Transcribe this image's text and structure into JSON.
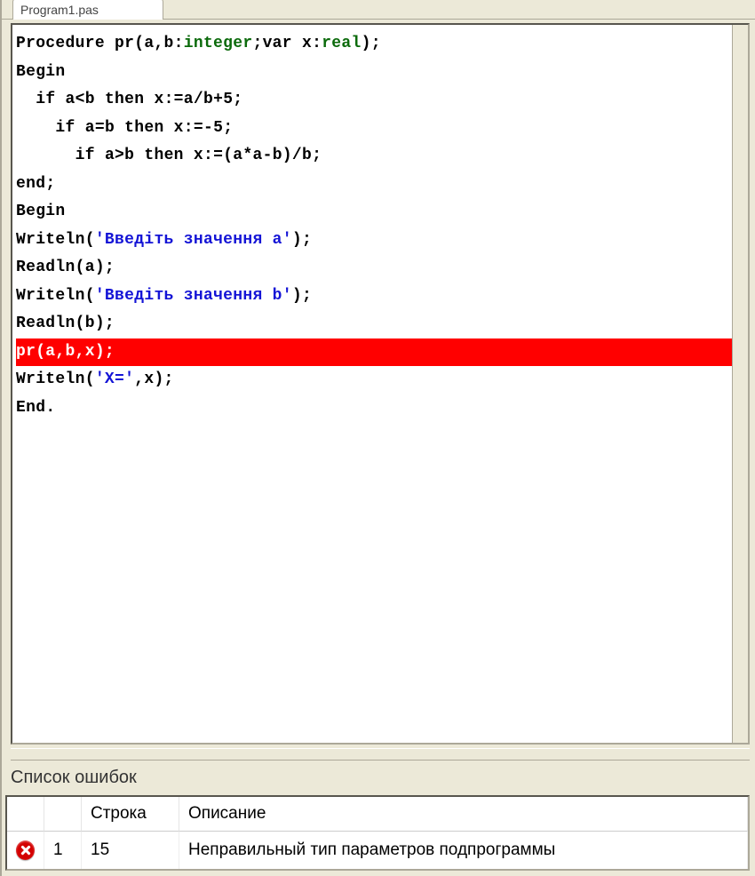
{
  "tab": {
    "label": "Program1.pas"
  },
  "code": {
    "lines": [
      {
        "indent": 0,
        "segments": [
          {
            "t": "Procedure",
            "c": "kw"
          },
          {
            "t": " pr(a,b:",
            "c": ""
          },
          {
            "t": "integer",
            "c": "type"
          },
          {
            "t": ";",
            "c": ""
          },
          {
            "t": "var",
            "c": "kw"
          },
          {
            "t": " x:",
            "c": ""
          },
          {
            "t": "real",
            "c": "type"
          },
          {
            "t": ");",
            "c": ""
          }
        ]
      },
      {
        "indent": 0,
        "segments": [
          {
            "t": "Begin",
            "c": "kw"
          }
        ]
      },
      {
        "indent": 1,
        "segments": [
          {
            "t": "if",
            "c": "kw"
          },
          {
            "t": " a<b ",
            "c": ""
          },
          {
            "t": "then",
            "c": "kw"
          },
          {
            "t": " x:=a/b+5;",
            "c": ""
          }
        ]
      },
      {
        "indent": 2,
        "segments": [
          {
            "t": "if",
            "c": "kw"
          },
          {
            "t": " a=b ",
            "c": ""
          },
          {
            "t": "then",
            "c": "kw"
          },
          {
            "t": " x:=-5;",
            "c": ""
          }
        ]
      },
      {
        "indent": 3,
        "segments": [
          {
            "t": "if",
            "c": "kw"
          },
          {
            "t": " a>b ",
            "c": ""
          },
          {
            "t": "then",
            "c": "kw"
          },
          {
            "t": " x:=(a*a-b)/b;",
            "c": ""
          }
        ]
      },
      {
        "indent": 0,
        "segments": [
          {
            "t": "end",
            "c": "kw"
          },
          {
            "t": ";",
            "c": ""
          }
        ]
      },
      {
        "indent": 0,
        "segments": [
          {
            "t": "Begin",
            "c": "kw"
          }
        ]
      },
      {
        "indent": 0,
        "segments": [
          {
            "t": "Writeln(",
            "c": ""
          },
          {
            "t": "'Введіть значення a'",
            "c": "str"
          },
          {
            "t": ");",
            "c": ""
          }
        ]
      },
      {
        "indent": 0,
        "segments": [
          {
            "t": "Readln(a);",
            "c": ""
          }
        ]
      },
      {
        "indent": 0,
        "segments": [
          {
            "t": "Writeln(",
            "c": ""
          },
          {
            "t": "'Введіть значення b'",
            "c": "str"
          },
          {
            "t": ");",
            "c": ""
          }
        ]
      },
      {
        "indent": 0,
        "segments": [
          {
            "t": "Readln(b);",
            "c": ""
          }
        ]
      },
      {
        "indent": 0,
        "highlight": true,
        "segments": [
          {
            "t": "pr(a,b,x);",
            "c": ""
          }
        ]
      },
      {
        "indent": 0,
        "segments": [
          {
            "t": "Writeln(",
            "c": ""
          },
          {
            "t": "'X='",
            "c": "str"
          },
          {
            "t": ",x);",
            "c": ""
          }
        ]
      },
      {
        "indent": 0,
        "segments": [
          {
            "t": "End",
            "c": "kw"
          },
          {
            "t": ".",
            "c": ""
          }
        ]
      }
    ]
  },
  "errors": {
    "panel_title": "Список ошибок",
    "columns": {
      "num": "",
      "line": "Строка",
      "desc": "Описание"
    },
    "rows": [
      {
        "icon": "error-icon",
        "num": "1",
        "line": "15",
        "desc": "Неправильный тип параметров подпрограммы"
      }
    ]
  }
}
